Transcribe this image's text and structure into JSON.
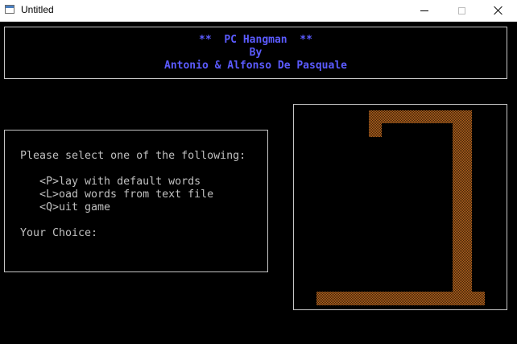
{
  "window": {
    "title": "Untitled"
  },
  "header": {
    "line1": "**  PC Hangman  **",
    "line2": "By",
    "line3": "Antonio & Alfonso De Pasquale"
  },
  "menu": {
    "prompt": "Please select one of the following:",
    "options": [
      "<P>lay with default words",
      "<L>oad words from text file",
      "<Q>uit game"
    ],
    "choice_label": "Your Choice:"
  },
  "colors": {
    "header_text": "#5b5bff",
    "menu_text": "#c0c0c0",
    "gallows": "#b8651f",
    "background": "#000000"
  }
}
